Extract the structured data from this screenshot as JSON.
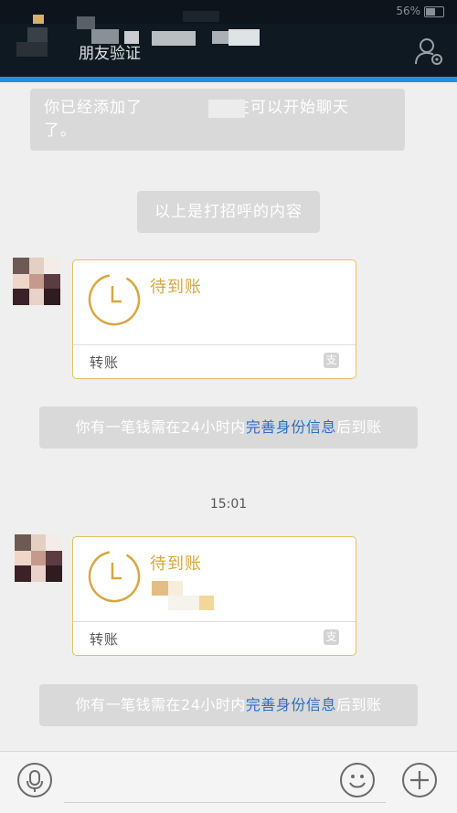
{
  "status_bar": {
    "battery": "56%"
  },
  "header": {
    "title": "朋友验证"
  },
  "messages": {
    "system_added": {
      "line1_start": "你已经添加了",
      "line1_end": "现在可以开始聊天",
      "line2": "了。"
    },
    "greeting": "以上是打招呼的内容",
    "transfer_1": {
      "status": "待到账",
      "type": "转账",
      "pay_glyph": "支"
    },
    "pending_1": {
      "before": "你有一笔钱需在24小时内",
      "highlight": "完善身份信息",
      "after": "后到账"
    },
    "timestamp": "15:01",
    "transfer_2": {
      "status": "待到账",
      "type": "转账",
      "pay_glyph": "支"
    },
    "pending_2": {
      "before": "你有一笔钱需在24小时内",
      "highlight": "完善身份信息",
      "after": "后到账"
    }
  },
  "colors": {
    "header_bg": "#0f1922",
    "accent": "#1f8fe6",
    "transfer_gold": "#d7a740",
    "link_blue": "#2a6fbf"
  }
}
